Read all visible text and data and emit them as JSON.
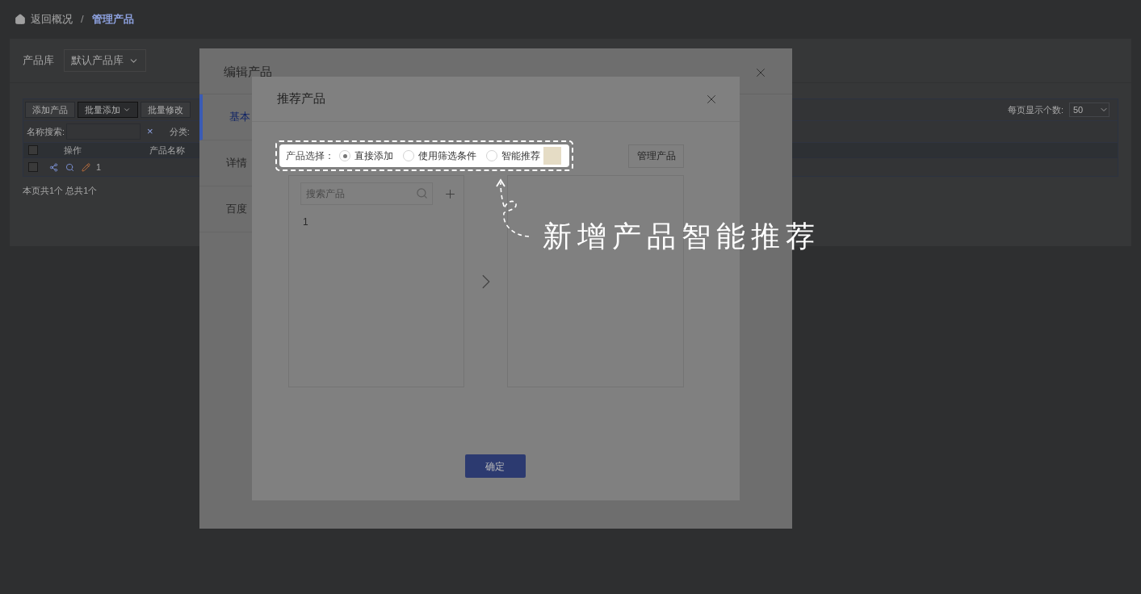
{
  "breadcrumb": {
    "back": "返回概况",
    "separator": "/",
    "current": "管理产品"
  },
  "library": {
    "label": "产品库",
    "value": "默认产品库"
  },
  "toolbar": {
    "buttons": [
      {
        "label": "添加产品",
        "kind": "plain"
      },
      {
        "label": "批量添加",
        "kind": "dropdown"
      },
      {
        "label": "批量修改",
        "kind": "plain"
      }
    ],
    "page_size_label": "每页显示个数:",
    "page_size": "50"
  },
  "filters": {
    "name_label": "名称搜索:",
    "clear": "×",
    "category_label": "分类:"
  },
  "table": {
    "select_all_checked": false,
    "columns": [
      "操作",
      "产品名称"
    ],
    "rows": [
      {
        "checked": false,
        "name": "1"
      }
    ]
  },
  "summary": "本页共1个 总共1个",
  "edit_dialog": {
    "title": "编辑产品",
    "tabs": [
      {
        "label": "基本",
        "selected": true
      },
      {
        "label": "详情",
        "selected": false
      },
      {
        "label": "百度",
        "selected": false
      }
    ]
  },
  "recommend_dialog": {
    "title": "推荐产品",
    "selection_label": "产品选择：",
    "options": [
      {
        "label": "直接添加",
        "selected": true
      },
      {
        "label": "使用筛选条件",
        "selected": false
      },
      {
        "label": "智能推荐",
        "selected": false
      }
    ],
    "manage_button": "管理产品",
    "search_placeholder": "搜索产品",
    "items": [
      "1"
    ],
    "confirm": "确定"
  },
  "annotation": "新增产品智能推荐"
}
